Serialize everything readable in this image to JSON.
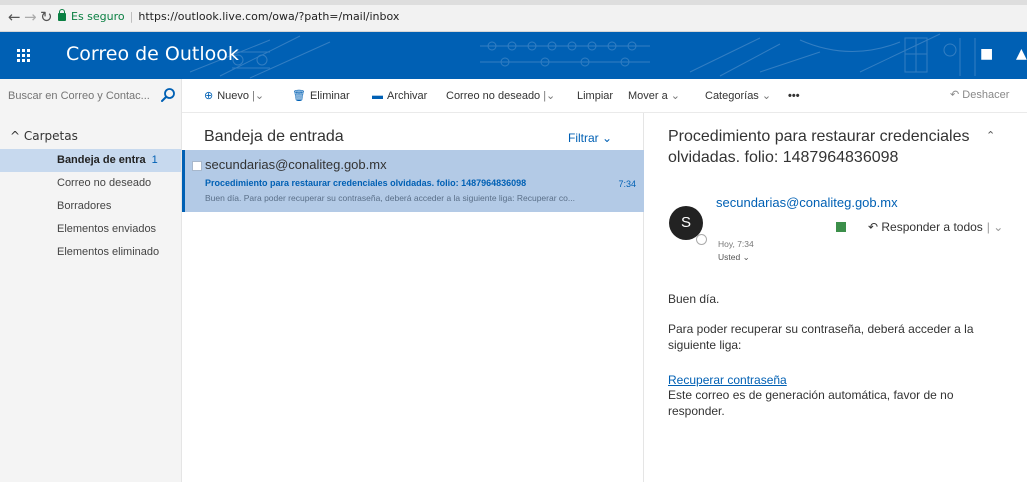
{
  "browser": {
    "secure_label": "Es seguro",
    "url": "https://outlook.live.com/owa/?path=/mail/inbox"
  },
  "header": {
    "app_title": "Correo de Outlook"
  },
  "search": {
    "placeholder": "Buscar en Correo y Contac..."
  },
  "toolbar": {
    "new_label": "Nuevo",
    "delete_label": "Eliminar",
    "archive_label": "Archivar",
    "junk_label": "Correo no deseado",
    "sweep_label": "Limpiar",
    "move_label": "Mover a",
    "categories_label": "Categorías",
    "more_label": "•••",
    "undo_label": "Deshacer"
  },
  "folders": {
    "header": "Carpetas",
    "items": [
      {
        "label": "Bandeja de entra",
        "count": "1"
      },
      {
        "label": "Correo no deseado"
      },
      {
        "label": "Borradores"
      },
      {
        "label": "Elementos enviados"
      },
      {
        "label": "Elementos eliminado"
      }
    ]
  },
  "list": {
    "title": "Bandeja de entrada",
    "filter_label": "Filtrar",
    "messages": [
      {
        "sender": "secundarias@conaliteg.gob.mx",
        "subject": "Procedimiento para restaurar credenciales olvidadas. folio: 1487964836098",
        "time": "7:34",
        "preview": "Buen día. Para poder recuperar su contraseña, deberá acceder a la siguiente liga: Recuperar co..."
      }
    ]
  },
  "reading": {
    "subject": "Procedimiento para restaurar credenciales olvidadas. folio: 1487964836098",
    "avatar_letter": "S",
    "sender": "secundarias@conaliteg.gob.mx",
    "reply_all_label": "Responder a todos",
    "date": "Hoy, 7:34",
    "to": "Usted",
    "body_greeting": "Buen día.",
    "body_para": "Para poder recuperar su contraseña, deberá acceder a la siguiente liga:",
    "body_link": "Recuperar contraseña",
    "body_footer": "Este correo es de generación automática, favor de no responder."
  },
  "colors": {
    "brand": "#0060b4",
    "selected_row": "#b3cae6",
    "selected_folder": "#c7d9ee"
  }
}
